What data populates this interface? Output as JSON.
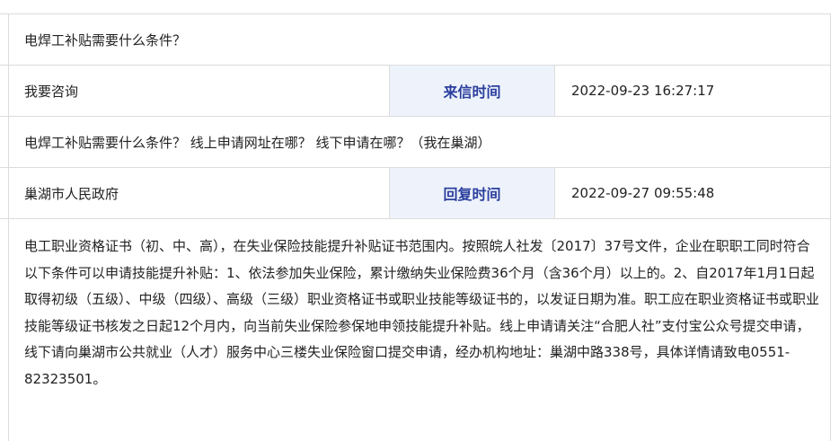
{
  "question": {
    "title": "电焊工补贴需要什么条件？",
    "asker": "我要咨询",
    "sent_label": "来信时间",
    "sent_time": "2022-09-23 16:27:17",
    "content": "电焊工补贴需要什么条件？ 线上申请网址在哪？ 线下申请在哪？（我在巢湖）"
  },
  "reply": {
    "department": "巢湖市人民政府",
    "reply_label": "回复时间",
    "reply_time": "2022-09-27 09:55:48",
    "content": "电工职业资格证书（初、中、高），在失业保险技能提升补贴证书范围内。按照皖人社发〔2017〕37号文件，企业在职职工同时符合以下条件可以申请技能提升补贴：1、依法参加失业保险，累计缴纳失业保险费36个月（含36个月）以上的。2、自2017年1月1日起取得初级（五级）、中级（四级）、高级（三级）职业资格证书或职业技能等级证书的，以发证日期为准。职工应在职业资格证书或职业技能等级证书核发之日起12个月内，向当前失业保险参保地申领技能提升补贴。线上申请请关注“合肥人社”支付宝公众号提交申请，线下请向巢湖市公共就业（人才）服务中心三楼失业保险窗口提交申请，经办机构地址：巢湖中路338号，具体详情请致电0551-82323501。"
  },
  "colors": {
    "label_text": "#2b3f9e",
    "label_bg": "#eef3fb",
    "border": "#dcdcdc"
  }
}
